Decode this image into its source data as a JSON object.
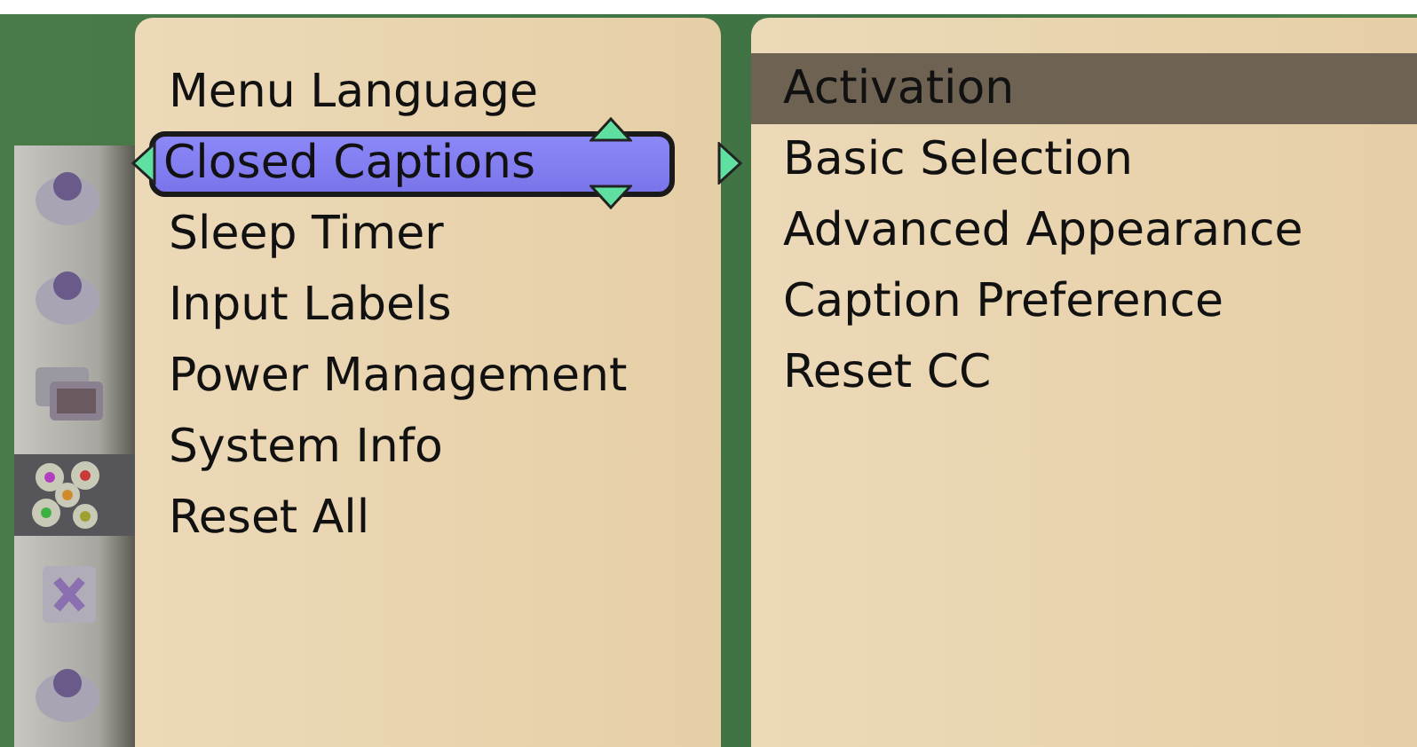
{
  "categories": [
    {
      "selected": false
    },
    {
      "selected": false
    },
    {
      "selected": false
    },
    {
      "selected": true
    },
    {
      "selected": false
    },
    {
      "selected": false
    }
  ],
  "menu": [
    {
      "label": "Menu Language",
      "selected": false
    },
    {
      "label": "Closed Captions",
      "selected": true
    },
    {
      "label": "Sleep Timer",
      "selected": false
    },
    {
      "label": "Input Labels",
      "selected": false
    },
    {
      "label": "Power Management",
      "selected": false
    },
    {
      "label": "System Info",
      "selected": false
    },
    {
      "label": "Reset All",
      "selected": false
    }
  ],
  "submenu": [
    {
      "label": "Activation",
      "selected": true
    },
    {
      "label": "Basic Selection",
      "selected": false
    },
    {
      "label": "Advanced Appearance",
      "selected": false
    },
    {
      "label": "Caption Preference",
      "selected": false
    },
    {
      "label": "Reset CC",
      "selected": false
    }
  ]
}
